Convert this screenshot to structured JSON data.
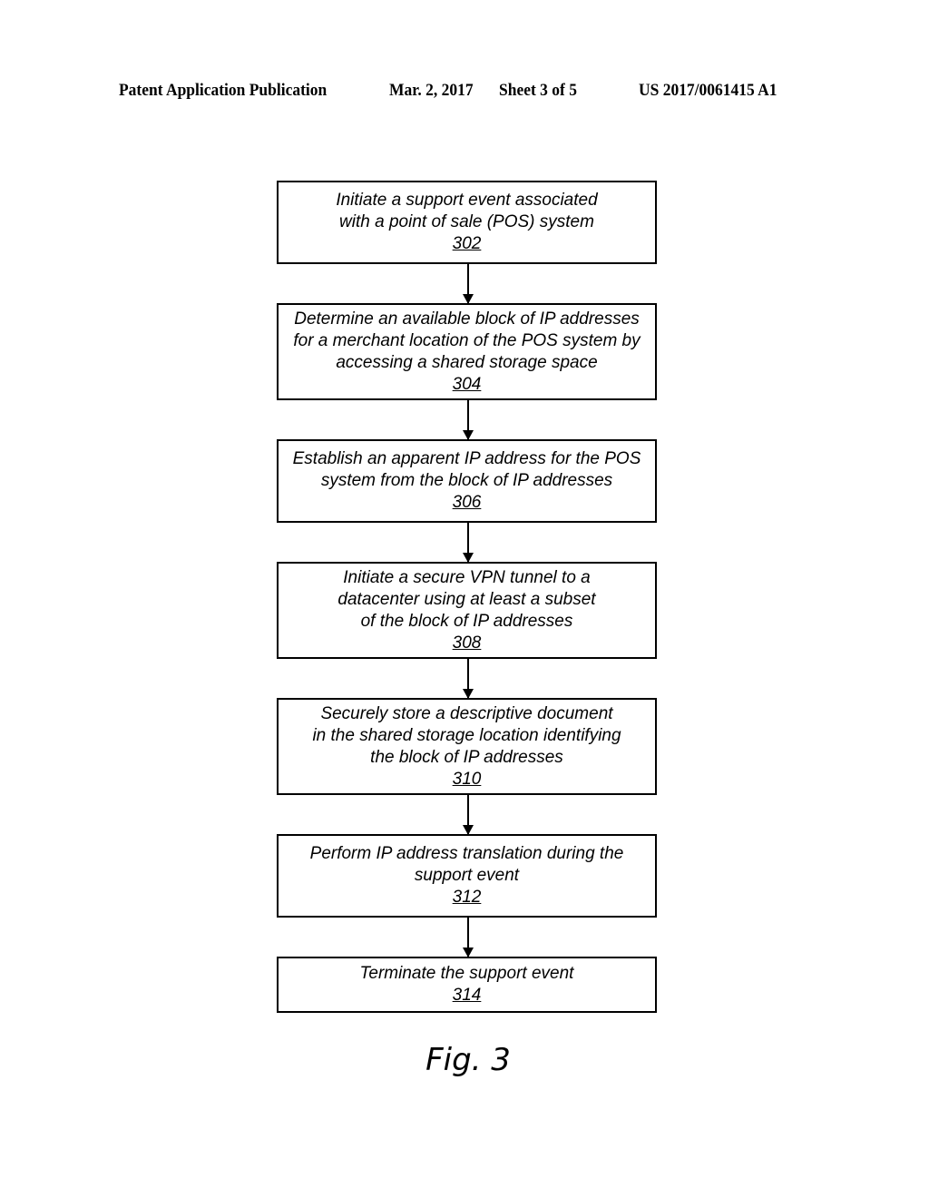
{
  "header": {
    "left": "Patent Application Publication",
    "date": "Mar. 2, 2017",
    "sheet": "Sheet 3 of 5",
    "number": "US 2017/0061415 A1"
  },
  "flowchart": {
    "steps": [
      {
        "lines": [
          "Initiate a support event associated",
          "with a point of sale (POS) system"
        ],
        "ref": "302"
      },
      {
        "lines": [
          "Determine an available block of IP addresses",
          "for a merchant location of the POS system by",
          "accessing a shared storage space"
        ],
        "ref": "304"
      },
      {
        "lines": [
          "Establish an apparent IP address for the POS",
          "system from the block of IP addresses"
        ],
        "ref": "306"
      },
      {
        "lines": [
          "Initiate a secure VPN tunnel to a",
          "datacenter using at least a subset",
          "of the block of IP addresses"
        ],
        "ref": "308"
      },
      {
        "lines": [
          "Securely store a descriptive document",
          "in the shared storage location identifying",
          "the block of IP addresses"
        ],
        "ref": "310"
      },
      {
        "lines": [
          "Perform IP address translation during the",
          "support event"
        ],
        "ref": "312"
      },
      {
        "lines": [
          "Terminate the support event"
        ],
        "ref": "314"
      }
    ]
  },
  "figure_label": "Fig. 3"
}
